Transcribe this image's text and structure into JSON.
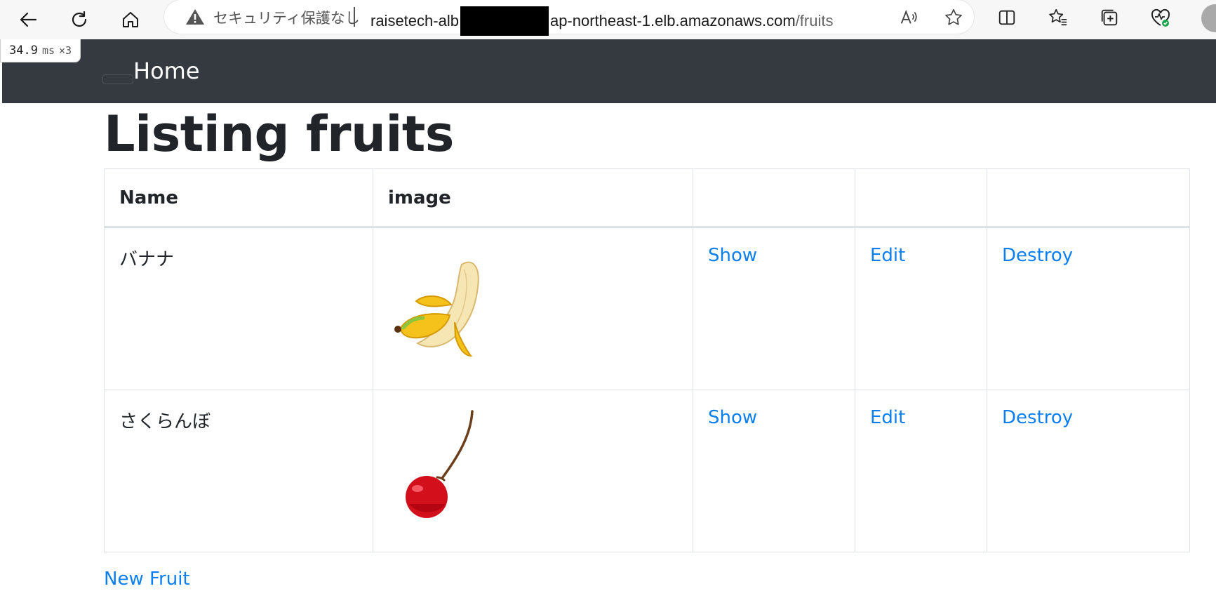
{
  "browser": {
    "security_label": "セキュリティ保護なし",
    "url_prefix": "raisetech-alb",
    "url_host_rest": "ap-northeast-1.elb.amazonaws.com",
    "url_path": "/fruits"
  },
  "timer": {
    "value": "34.9",
    "unit": "ms",
    "multiplier": "×3"
  },
  "navbar": {
    "brand": "Home"
  },
  "page": {
    "title": "Listing fruits"
  },
  "table": {
    "headers": [
      "Name",
      "image",
      "",
      "",
      ""
    ],
    "rows": [
      {
        "name": "バナナ",
        "image_icon": "banana-image",
        "show": "Show",
        "edit": "Edit",
        "destroy": "Destroy"
      },
      {
        "name": "さくらんぼ",
        "image_icon": "cherry-image",
        "show": "Show",
        "edit": "Edit",
        "destroy": "Destroy"
      }
    ]
  },
  "new_link": "New Fruit",
  "colors": {
    "navbar": "#343a40",
    "link": "#0c7ff0",
    "border": "#dee2e6"
  }
}
